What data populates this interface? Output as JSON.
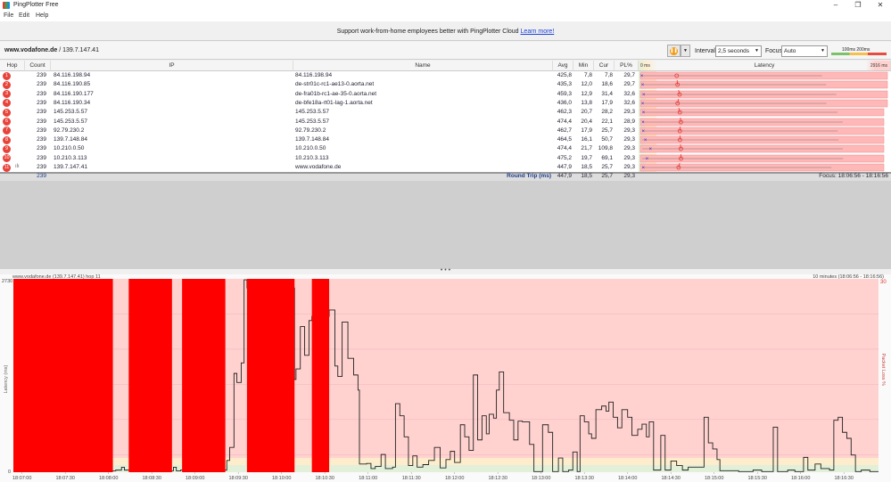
{
  "window": {
    "title": "PingPlotter Free"
  },
  "menu": [
    "File",
    "Edit",
    "Help"
  ],
  "banner": {
    "text": "Support work-from-home employees better with PingPlotter Cloud",
    "link": "Learn more!"
  },
  "toolbar": {
    "target_host": "www.vodafone.de",
    "target_ip": "/ 139.7.147.41",
    "interval_label": "Interval",
    "interval_value": "2,5 seconds",
    "focus_label": "Focus",
    "focus_value": "Auto",
    "scale_100": "100ms",
    "scale_200": "200ms"
  },
  "table": {
    "headers": {
      "hop": "Hop",
      "count": "Count",
      "ip": "IP",
      "name": "Name",
      "avg": "Avg",
      "min": "Min",
      "cur": "Cur",
      "pl": "PL%",
      "latency": "Latency",
      "lat_min": "0 ms",
      "lat_max": "2916 ms"
    },
    "latency_max_ms": 2916,
    "rows": [
      {
        "hop": "1",
        "count": "239",
        "ip": "84.116.198.94",
        "name": "84.116.198.94",
        "avg": "425,8",
        "min": "7,8",
        "cur": "7,8",
        "pl": "29,7"
      },
      {
        "hop": "2",
        "count": "239",
        "ip": "84.116.190.85",
        "name": "de-str01c-rc1-ae13-0.aorta.net",
        "avg": "435,3",
        "min": "12,0",
        "cur": "18,6",
        "pl": "29,7"
      },
      {
        "hop": "3",
        "count": "239",
        "ip": "84.116.190.177",
        "name": "de-fra01b-rc1-ae-35-0.aorta.net",
        "avg": "459,3",
        "min": "12,9",
        "cur": "31,4",
        "pl": "32,6"
      },
      {
        "hop": "4",
        "count": "239",
        "ip": "84.116.190.34",
        "name": "de-bfe18a-rt01-lag-1.aorta.net",
        "avg": "436,0",
        "min": "13,8",
        "cur": "17,9",
        "pl": "32,6"
      },
      {
        "hop": "5",
        "count": "239",
        "ip": "145.253.5.57",
        "name": "145.253.5.57",
        "avg": "462,3",
        "min": "20,7",
        "cur": "28,2",
        "pl": "29,3"
      },
      {
        "hop": "6",
        "count": "239",
        "ip": "145.253.5.57",
        "name": "145.253.5.57",
        "avg": "474,4",
        "min": "20,4",
        "cur": "22,1",
        "pl": "28,9"
      },
      {
        "hop": "7",
        "count": "239",
        "ip": "92.79.230.2",
        "name": "92.79.230.2",
        "avg": "462,7",
        "min": "17,9",
        "cur": "25,7",
        "pl": "29,3"
      },
      {
        "hop": "8",
        "count": "239",
        "ip": "139.7.148.84",
        "name": "139.7.148.84",
        "avg": "464,5",
        "min": "16,1",
        "cur": "50,7",
        "pl": "29,3"
      },
      {
        "hop": "9",
        "count": "239",
        "ip": "10.210.0.50",
        "name": "10.210.0.50",
        "avg": "474,4",
        "min": "21,7",
        "cur": "109,8",
        "pl": "29,3"
      },
      {
        "hop": "10",
        "count": "239",
        "ip": "10.210.3.113",
        "name": "10.210.3.113",
        "avg": "475,2",
        "min": "19,7",
        "cur": "69,1",
        "pl": "29,3"
      },
      {
        "hop": "11",
        "count": "239",
        "ip": "139.7.147.41",
        "name": "www.vodafone.de",
        "avg": "447,9",
        "min": "18,5",
        "cur": "25,7",
        "pl": "29,3"
      }
    ],
    "summary": {
      "count": "239",
      "label": "Round Trip (ms)",
      "avg": "447,9",
      "min": "18,5",
      "cur": "25,7",
      "pl": "29,3",
      "focus": "Focus: 18:06:56 - 18:16:56"
    }
  },
  "chart_data": {
    "type": "line",
    "title": "www.vodafone.de (139.7.147.41) hop 11",
    "range_label": "10 minutes (18:06:56 - 18:16:56)",
    "ylabel": "Latency (ms)",
    "y2label": "Packet Loss %",
    "ylim": [
      0,
      2730
    ],
    "y_top_label": "2730",
    "y_bottom_label": "0",
    "y2_top_label": "30",
    "x_unit": "seconds after 18:07:00",
    "xlim": [
      -6,
      594
    ],
    "x_ticks": [
      "18:07:00",
      "18:07:30",
      "18:08:00",
      "18:08:30",
      "18:09:00",
      "18:09:30",
      "18:10:00",
      "18:10:30",
      "18:11:00",
      "18:11:30",
      "18:12:00",
      "18:12:30",
      "18:13:00",
      "18:13:30",
      "18:14:00",
      "18:14:30",
      "18:15:00",
      "18:15:30",
      "18:16:00",
      "18:16:30"
    ],
    "thresholds_ms": {
      "good": 100,
      "warn": 200
    },
    "colors": {
      "good": "#e2f0d9",
      "warn": "#fdedcc",
      "bad": "#ffd2cf",
      "loss": "#ff0000",
      "line": "#222222"
    },
    "loss_segments": [
      [
        -6,
        63
      ],
      [
        74,
        104
      ],
      [
        111,
        141
      ],
      [
        156,
        189
      ],
      [
        201,
        213
      ]
    ],
    "points": [
      [
        -6,
        20
      ],
      [
        65,
        30
      ],
      [
        69,
        70
      ],
      [
        71,
        30
      ],
      [
        75,
        20
      ],
      [
        105,
        70
      ],
      [
        107,
        20
      ],
      [
        110,
        30
      ],
      [
        142,
        166
      ],
      [
        144,
        350
      ],
      [
        147,
        1395
      ],
      [
        149,
        1267
      ],
      [
        152,
        1544
      ],
      [
        154,
        2717
      ],
      [
        156,
        2600
      ],
      [
        189,
        1310
      ],
      [
        190,
        1459
      ],
      [
        193,
        2056
      ],
      [
        196,
        1650
      ],
      [
        199,
        2141
      ],
      [
        201,
        2200
      ],
      [
        213,
        2290
      ],
      [
        215,
        2290
      ],
      [
        217,
        1500
      ],
      [
        219,
        1352
      ],
      [
        222,
        2120
      ],
      [
        226,
        1608
      ],
      [
        230,
        1373
      ],
      [
        233,
        1160
      ],
      [
        234,
        115
      ],
      [
        239,
        124
      ],
      [
        242,
        51
      ],
      [
        245,
        81
      ],
      [
        249,
        250
      ],
      [
        252,
        51
      ],
      [
        257,
        72
      ],
      [
        259,
        968
      ],
      [
        262,
        797
      ],
      [
        265,
        499
      ],
      [
        268,
        94
      ],
      [
        271,
        230
      ],
      [
        274,
        72
      ],
      [
        278,
        107
      ],
      [
        282,
        166
      ],
      [
        286,
        350
      ],
      [
        290,
        60
      ],
      [
        294,
        179
      ],
      [
        297,
        294
      ],
      [
        300,
        137
      ],
      [
        304,
        670
      ],
      [
        307,
        499
      ],
      [
        310,
        307
      ],
      [
        313,
        1373
      ],
      [
        316,
        456
      ],
      [
        319,
        797
      ],
      [
        322,
        542
      ],
      [
        324,
        819
      ],
      [
        327,
        764
      ],
      [
        329,
        1160
      ],
      [
        331,
        1416
      ],
      [
        334,
        840
      ],
      [
        338,
        734
      ],
      [
        341,
        456
      ],
      [
        344,
        721
      ],
      [
        347,
        712
      ],
      [
        352,
        392
      ],
      [
        355,
        9
      ],
      [
        361,
        670
      ],
      [
        365,
        563
      ],
      [
        368,
        9
      ],
      [
        372,
        200
      ],
      [
        375,
        9
      ],
      [
        379,
        30
      ],
      [
        382,
        286
      ],
      [
        385,
        9
      ],
      [
        387,
        797
      ],
      [
        390,
        712
      ],
      [
        393,
        542
      ],
      [
        395,
        478
      ],
      [
        398,
        883
      ],
      [
        402,
        934
      ],
      [
        405,
        862
      ],
      [
        407,
        990
      ],
      [
        410,
        776
      ],
      [
        413,
        627
      ],
      [
        416,
        883
      ],
      [
        420,
        776
      ],
      [
        423,
        520
      ],
      [
        427,
        606
      ],
      [
        430,
        678
      ],
      [
        433,
        499
      ],
      [
        435,
        712
      ],
      [
        438,
        30
      ],
      [
        443,
        520
      ],
      [
        446,
        30
      ],
      [
        450,
        158
      ],
      [
        454,
        94
      ],
      [
        458,
        30
      ],
      [
        462,
        72
      ],
      [
        469,
        72
      ],
      [
        473,
        776
      ],
      [
        476,
        414
      ],
      [
        479,
        328
      ],
      [
        482,
        179
      ],
      [
        484,
        21
      ],
      [
        497,
        9
      ],
      [
        507,
        30
      ],
      [
        513,
        9
      ],
      [
        521,
        636
      ],
      [
        524,
        9
      ],
      [
        531,
        30
      ],
      [
        536,
        9
      ],
      [
        542,
        209
      ],
      [
        545,
        30
      ],
      [
        550,
        115
      ],
      [
        554,
        51
      ],
      [
        560,
        30
      ],
      [
        563,
        734
      ],
      [
        566,
        776
      ],
      [
        569,
        563
      ],
      [
        572,
        478
      ],
      [
        575,
        243
      ],
      [
        578,
        9
      ],
      [
        582,
        30
      ],
      [
        588,
        9
      ],
      [
        594,
        9
      ]
    ]
  }
}
